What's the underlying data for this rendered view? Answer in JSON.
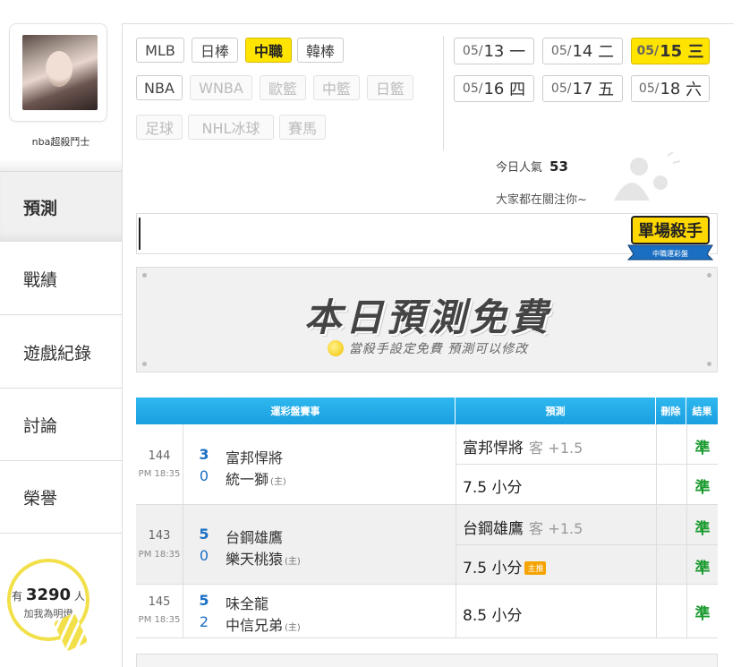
{
  "user": {
    "name": "nba超殺鬥士",
    "fans_prefix": "有",
    "fans_count": "3290",
    "fans_suffix": "人",
    "fans_sub": "加我為明燈"
  },
  "nav": [
    {
      "label": "預測",
      "active": true
    },
    {
      "label": "戰績"
    },
    {
      "label": "遊戲紀錄"
    },
    {
      "label": "討論"
    },
    {
      "label": "榮譽"
    }
  ],
  "sports": [
    {
      "label": "MLB"
    },
    {
      "label": "日棒"
    },
    {
      "label": "中職",
      "active": true
    },
    {
      "label": "韓棒"
    },
    {
      "label": "NBA"
    },
    {
      "label": "WNBA",
      "disabled": true
    },
    {
      "label": "歐籃",
      "disabled": true
    },
    {
      "label": "中籃",
      "disabled": true
    },
    {
      "label": "日籃",
      "disabled": true
    },
    {
      "label": "足球",
      "disabled": true
    },
    {
      "label": "NHL冰球",
      "disabled": true
    },
    {
      "label": "賽馬",
      "disabled": true
    }
  ],
  "dates": [
    {
      "md": "05/",
      "d": "13",
      "wd": "一"
    },
    {
      "md": "05/",
      "d": "14",
      "wd": "二"
    },
    {
      "md": "05/",
      "d": "15",
      "wd": "三",
      "active": true
    },
    {
      "md": "05/",
      "d": "16",
      "wd": "四"
    },
    {
      "md": "05/",
      "d": "17",
      "wd": "五"
    },
    {
      "md": "05/",
      "d": "18",
      "wd": "六"
    }
  ],
  "popularity": {
    "label": "今日人氣",
    "value": "53",
    "sub": "大家都在關注你~"
  },
  "badge": {
    "title": "單場殺手",
    "ribbon": "中職運彩盤"
  },
  "free_banner": {
    "title": "本日預測免費",
    "subtitle": "當殺手設定免費  預測可以修改"
  },
  "table": {
    "headers": {
      "event": "運彩盤賽事",
      "prediction": "預測",
      "delete": "刪除",
      "result": "結果"
    },
    "games": [
      {
        "no": "144",
        "time": "PM 18:35",
        "away_score": "3",
        "away": "富邦悍將",
        "home_score": "0",
        "home": "統一獅",
        "home_tag": "(主)",
        "preds": [
          {
            "team": "富邦悍將",
            "side": "客",
            "line": "+1.5",
            "result": "準"
          },
          {
            "text": "7.5 小分",
            "result": "準"
          }
        ]
      },
      {
        "no": "143",
        "time": "PM 18:35",
        "away_score": "5",
        "away": "台鋼雄鷹",
        "home_score": "0",
        "home": "樂天桃猿",
        "home_tag": "(主)",
        "preds": [
          {
            "team": "台鋼雄鷹",
            "side": "客",
            "line": "+1.5",
            "result": "準"
          },
          {
            "text": "7.5 小分",
            "pill": "主推",
            "result": "準"
          }
        ]
      },
      {
        "no": "145",
        "time": "PM 18:35",
        "away_score": "5",
        "away": "味全龍",
        "home_score": "2",
        "home": "中信兄弟",
        "home_tag": "(主)",
        "preds": [
          {
            "text": "8.5 小分",
            "result": "準"
          }
        ]
      }
    ]
  }
}
